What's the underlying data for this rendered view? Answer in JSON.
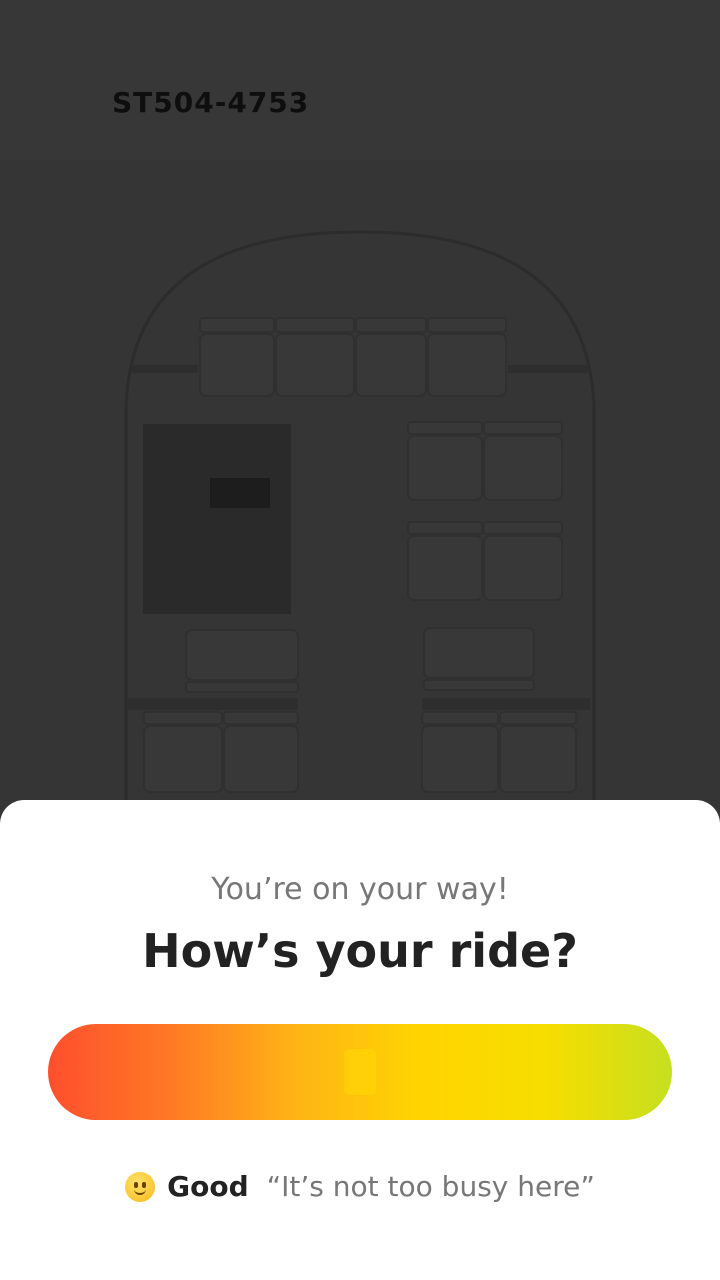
{
  "header": {
    "train_id": "ST504-4753"
  },
  "sheet": {
    "subtitle": "You’re on your way!",
    "title": "How’s your ride?",
    "slider": {
      "value": 0.5,
      "colors": [
        "#ff4f2e",
        "#ff7a24",
        "#ffb515",
        "#ffd400",
        "#f6de00",
        "#c6df20"
      ]
    },
    "status": {
      "emoji": "slightly-smiling-face-icon",
      "level": "Good",
      "quote": "“It’s not too busy here”"
    }
  }
}
